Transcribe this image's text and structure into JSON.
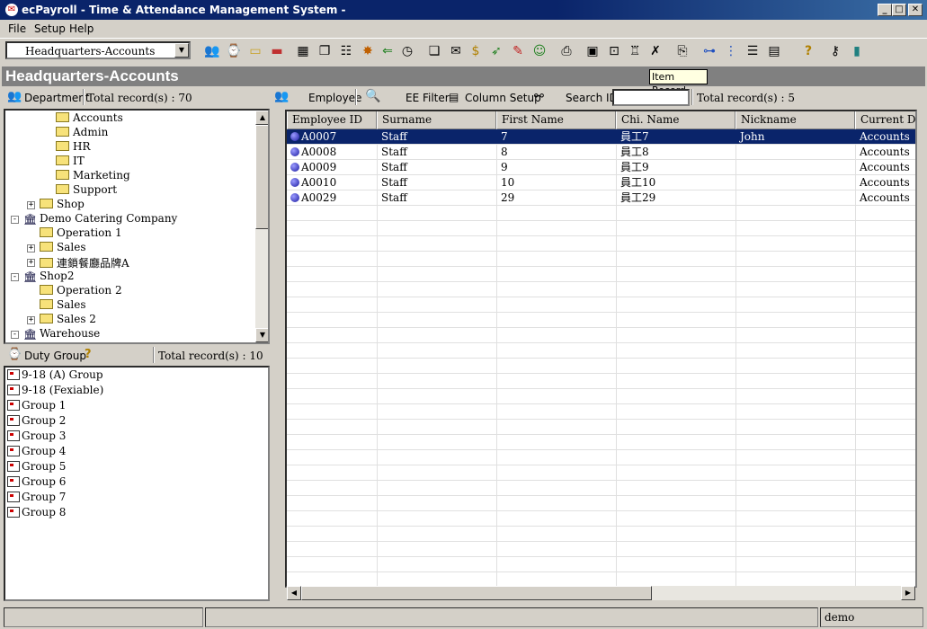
{
  "window": {
    "title": "ecPayroll - Time & Attendance Management System -"
  },
  "menu": [
    "File",
    "Setup",
    "Help"
  ],
  "toolbar": {
    "department_select": "Headquarters-Accounts"
  },
  "banner": {
    "title": "Headquarters-Accounts",
    "tooltip": "Item Record"
  },
  "department_panel": {
    "label": "Department",
    "total": "Total record(s) : 70",
    "tree": [
      {
        "label": "Accounts",
        "level": 3,
        "type": "folder"
      },
      {
        "label": "Admin",
        "level": 3,
        "type": "folder"
      },
      {
        "label": "HR",
        "level": 3,
        "type": "folder"
      },
      {
        "label": "IT",
        "level": 3,
        "type": "folder"
      },
      {
        "label": "Marketing",
        "level": 3,
        "type": "folder"
      },
      {
        "label": "Support",
        "level": 3,
        "type": "folder"
      },
      {
        "label": "Shop",
        "level": 2,
        "type": "folder",
        "expander": "+"
      },
      {
        "label": "Demo Catering Company",
        "level": 1,
        "type": "building",
        "expander": "-"
      },
      {
        "label": "Operation 1",
        "level": 2,
        "type": "folder"
      },
      {
        "label": "Sales",
        "level": 2,
        "type": "folder",
        "expander": "+"
      },
      {
        "label": "連鎖餐廳品牌A",
        "level": 2,
        "type": "folder",
        "expander": "+"
      },
      {
        "label": "Shop2",
        "level": 1,
        "type": "building",
        "expander": "-"
      },
      {
        "label": "Operation 2",
        "level": 2,
        "type": "folder"
      },
      {
        "label": "Sales",
        "level": 2,
        "type": "folder"
      },
      {
        "label": "Sales 2",
        "level": 2,
        "type": "folder",
        "expander": "+"
      },
      {
        "label": "Warehouse",
        "level": 1,
        "type": "building",
        "expander": "-"
      }
    ]
  },
  "duty_group_panel": {
    "label": "Duty Group",
    "total": "Total record(s) : 10",
    "groups": [
      "9-18 (A) Group",
      "9-18 (Fexiable)",
      "Group 1",
      "Group 2",
      "Group 3",
      "Group 4",
      "Group 5",
      "Group 6",
      "Group 7",
      "Group 8"
    ]
  },
  "employee_bar": {
    "employee_label": "Employee",
    "filter_label": "EE Filter",
    "column_setup_label": "Column Setup",
    "search_label": "Search ID",
    "search_value": "",
    "total": "Total record(s) : 5"
  },
  "grid": {
    "columns": [
      "Employee ID",
      "Surname",
      "First Name",
      "Chi. Name",
      "Nickname",
      "Current Depa"
    ],
    "rows": [
      [
        "A0007",
        "Staff",
        "7",
        "員工7",
        "John",
        "Accounts"
      ],
      [
        "A0008",
        "Staff",
        "8",
        "員工8",
        "",
        "Accounts"
      ],
      [
        "A0009",
        "Staff",
        "9",
        "員工9",
        "",
        "Accounts"
      ],
      [
        "A0010",
        "Staff",
        "10",
        "員工10",
        "",
        "Accounts"
      ],
      [
        "A0029",
        "Staff",
        "29",
        "員工29",
        "",
        "Accounts"
      ]
    ],
    "selected_row": 0
  },
  "status": {
    "user": "demo"
  }
}
